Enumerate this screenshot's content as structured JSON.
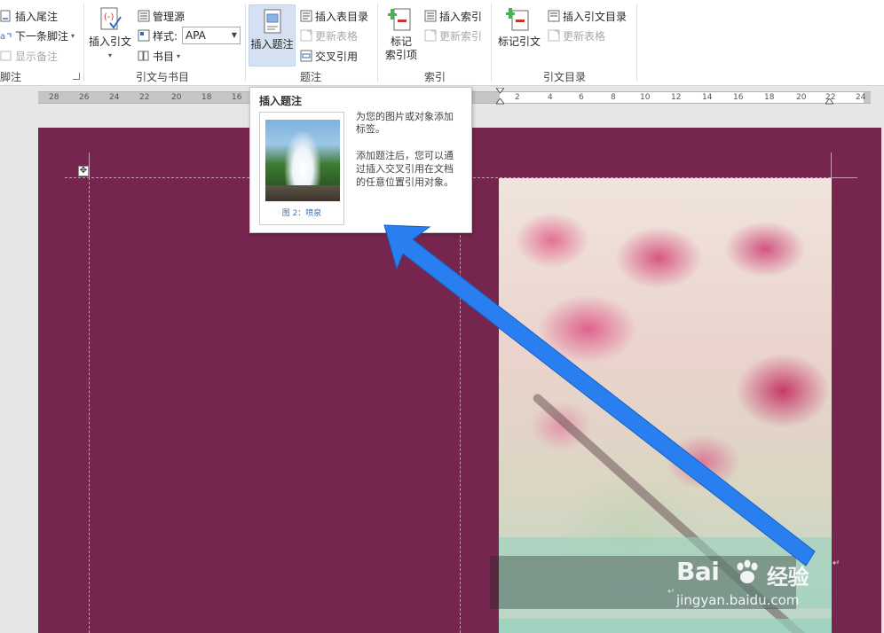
{
  "ribbon": {
    "footnotes": {
      "insert_endnote": "插入尾注",
      "next_footnote": "下一条脚注",
      "show_notes": "显示备注",
      "group_label": "脚注"
    },
    "citations": {
      "insert_citation": "插入引文",
      "manage_sources": "管理源",
      "style_label": "样式:",
      "style_value": "APA",
      "bibliography": "书目",
      "group_label": "引文与书目"
    },
    "captions": {
      "insert_caption": "插入题注",
      "insert_table_of_figures": "插入表目录",
      "update_table": "更新表格",
      "cross_reference": "交叉引用",
      "group_label": "题注"
    },
    "index": {
      "mark_entry_line1": "标记",
      "mark_entry_line2": "索引项",
      "insert_index": "插入索引",
      "update_index": "更新索引",
      "group_label": "索引"
    },
    "authorities": {
      "mark_citation": "标记引文",
      "insert_table_of_authorities": "插入引文目录",
      "update_table": "更新表格",
      "group_label": "引文目录"
    }
  },
  "ruler": {
    "left_numbers": [
      "28",
      "26",
      "24",
      "22",
      "20",
      "18",
      "16"
    ],
    "right_numbers": [
      "2",
      "2",
      "4",
      "6",
      "8",
      "10",
      "12",
      "14",
      "16",
      "18",
      "20",
      "22",
      "24"
    ]
  },
  "tooltip": {
    "title": "插入题注",
    "preview_caption": "图 2：喷泉",
    "description_1": "为您的图片或对象添加",
    "description_2": "标签。",
    "description_3": "添加题注后，您可以通",
    "description_4": "过插入交叉引用在文档",
    "description_5": "的任意位置引用对象。"
  },
  "document": {
    "paragraph_mark": "↵"
  },
  "watermark": {
    "brand_a": "Bai",
    "brand_b": "经验",
    "url": "jingyan.baidu.com"
  },
  "colors": {
    "page_background": "#76264e",
    "arrow": "#2a7ff0",
    "ribbon_active": "#d5e1f2",
    "caption_blue": "#3b73b9"
  }
}
